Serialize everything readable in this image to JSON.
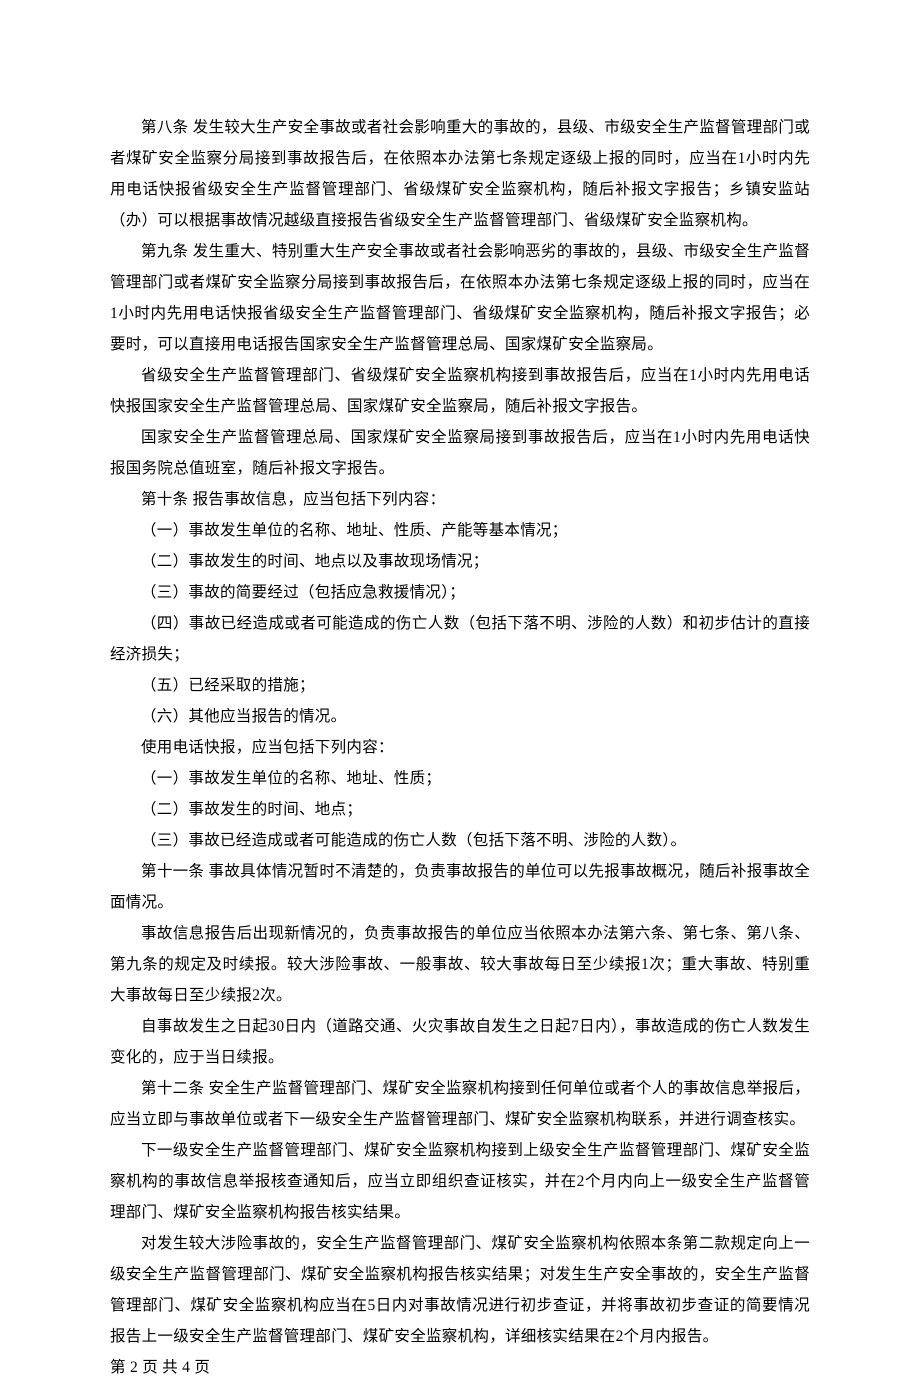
{
  "paragraphs": [
    "第八条 发生较大生产安全事故或者社会影响重大的事故的，县级、市级安全生产监督管理部门或者煤矿安全监察分局接到事故报告后，在依照本办法第七条规定逐级上报的同时，应当在1小时内先用电话快报省级安全生产监督管理部门、省级煤矿安全监察机构，随后补报文字报告；乡镇安监站（办）可以根据事故情况越级直接报告省级安全生产监督管理部门、省级煤矿安全监察机构。",
    "第九条 发生重大、特别重大生产安全事故或者社会影响恶劣的事故的，县级、市级安全生产监督管理部门或者煤矿安全监察分局接到事故报告后，在依照本办法第七条规定逐级上报的同时，应当在1小时内先用电话快报省级安全生产监督管理部门、省级煤矿安全监察机构，随后补报文字报告；必要时，可以直接用电话报告国家安全生产监督管理总局、国家煤矿安全监察局。",
    "省级安全生产监督管理部门、省级煤矿安全监察机构接到事故报告后，应当在1小时内先用电话快报国家安全生产监督管理总局、国家煤矿安全监察局，随后补报文字报告。",
    "国家安全生产监督管理总局、国家煤矿安全监察局接到事故报告后，应当在1小时内先用电话快报国务院总值班室，随后补报文字报告。",
    "第十条 报告事故信息，应当包括下列内容：",
    "（一）事故发生单位的名称、地址、性质、产能等基本情况；",
    "（二）事故发生的时间、地点以及事故现场情况；",
    "（三）事故的简要经过（包括应急救援情况）；",
    "（四）事故已经造成或者可能造成的伤亡人数（包括下落不明、涉险的人数）和初步估计的直接经济损失；",
    "（五）已经采取的措施；",
    "（六）其他应当报告的情况。",
    "使用电话快报，应当包括下列内容：",
    "（一）事故发生单位的名称、地址、性质；",
    "（二）事故发生的时间、地点；",
    "（三）事故已经造成或者可能造成的伤亡人数（包括下落不明、涉险的人数）。",
    "第十一条 事故具体情况暂时不清楚的，负责事故报告的单位可以先报事故概况，随后补报事故全面情况。",
    "事故信息报告后出现新情况的，负责事故报告的单位应当依照本办法第六条、第七条、第八条、第九条的规定及时续报。较大涉险事故、一般事故、较大事故每日至少续报1次；重大事故、特别重大事故每日至少续报2次。",
    "自事故发生之日起30日内（道路交通、火灾事故自发生之日起7日内），事故造成的伤亡人数发生变化的，应于当日续报。",
    "第十二条 安全生产监督管理部门、煤矿安全监察机构接到任何单位或者个人的事故信息举报后，应当立即与事故单位或者下一级安全生产监督管理部门、煤矿安全监察机构联系，并进行调查核实。",
    "下一级安全生产监督管理部门、煤矿安全监察机构接到上级安全生产监督管理部门、煤矿安全监察机构的事故信息举报核查通知后，应当立即组织查证核实，并在2个月内向上一级安全生产监督管理部门、煤矿安全监察机构报告核实结果。",
    "对发生较大涉险事故的，安全生产监督管理部门、煤矿安全监察机构依照本条第二款规定向上一级安全生产监督管理部门、煤矿安全监察机构报告核实结果；对发生生产安全事故的，安全生产监督管理部门、煤矿安全监察机构应当在5日内对事故情况进行初步查证，并将事故初步查证的简要情况报告上一级安全生产监督管理部门、煤矿安全监察机构，详细核实结果在2个月内报告。"
  ],
  "footer": "第 2 页 共 4 页"
}
